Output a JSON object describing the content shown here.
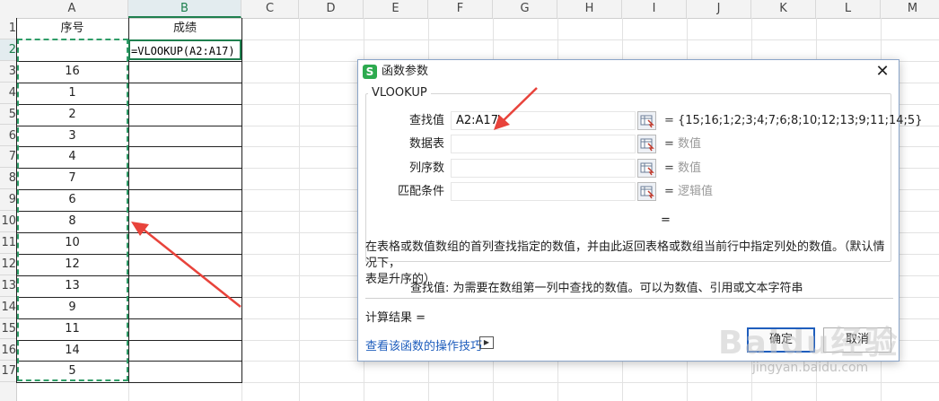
{
  "sheet": {
    "columns": [
      "A",
      "B",
      "C",
      "D",
      "E",
      "F",
      "G",
      "H",
      "I",
      "J",
      "K",
      "L",
      "M"
    ],
    "rows": [
      "1",
      "2",
      "3",
      "4",
      "5",
      "6",
      "7",
      "8",
      "9",
      "10",
      "11",
      "12",
      "13",
      "14",
      "15",
      "16",
      "17"
    ],
    "header_a": "序号",
    "header_b": "成绩",
    "formula": "=VLOOKUP(A2:A17)",
    "a_values": [
      "",
      "16",
      "1",
      "2",
      "3",
      "4",
      "7",
      "6",
      "8",
      "10",
      "12",
      "13",
      "9",
      "11",
      "14",
      "5"
    ],
    "colors": {
      "selection": "#1e7f4e",
      "marching_ants": "#2f9d68",
      "annotation_arrow": "#e8433b"
    }
  },
  "dialog": {
    "title": "函数参数",
    "logo": "S",
    "function_name": "VLOOKUP",
    "args": [
      {
        "label": "查找值",
        "value": "A2:A17",
        "equals": "=",
        "result": "{15;16;1;2;3;4;7;6;8;10;12;13;9;11;14;5}",
        "hint": false
      },
      {
        "label": "数据表",
        "value": "",
        "equals": "=",
        "result": "数值",
        "hint": true
      },
      {
        "label": "列序数",
        "value": "",
        "equals": "=",
        "result": "数值",
        "hint": true
      },
      {
        "label": "匹配条件",
        "value": "",
        "equals": "=",
        "result": "逻辑值",
        "hint": true
      }
    ],
    "result_equals": "=",
    "description_line1": "在表格或数值数组的首列查找指定的数值，并由此返回表格或数组当前行中指定列处的数值。（默认情况下，",
    "description_line2": "表是升序的）",
    "param_desc": "查找值:  为需要在数组第一列中查找的数值。可以为数值、引用或文本字符串",
    "calc_result": "计算结果  =",
    "help_link": "查看该函数的操作技巧",
    "ok_label": "确定",
    "cancel_label": "取消",
    "close_icon": "close-icon",
    "ref_icon": "range-select-icon"
  },
  "watermark": {
    "brand": "Baidu经验",
    "url": "jingyan.baidu.com"
  }
}
